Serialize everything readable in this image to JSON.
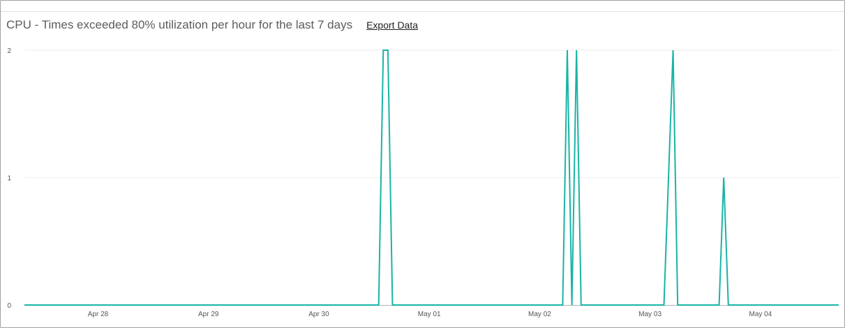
{
  "chart_data": {
    "type": "line",
    "title": "CPU - Times exceeded 80% utilization per hour for the last 7 days",
    "xlabel": "",
    "ylabel": "",
    "x_ticks": [
      "Apr 28",
      "Apr 29",
      "Apr 30",
      "May 01",
      "May 02",
      "May 03",
      "May 04"
    ],
    "y_ticks": [
      "0",
      "1",
      "2"
    ],
    "ylim": [
      0,
      2
    ],
    "xlim": [
      "Apr 27 08:00",
      "May 04 17:00"
    ],
    "grid": true,
    "legend": "none",
    "colors": {
      "line": "#18b4a6",
      "grid": "#ececec",
      "axis": "#b5b5b5"
    },
    "series": [
      {
        "points": [
          [
            "Apr 27 08:00",
            0
          ],
          [
            "Apr 30 13:00",
            0
          ],
          [
            "Apr 30 14:00",
            2
          ],
          [
            "Apr 30 15:00",
            2
          ],
          [
            "Apr 30 16:00",
            0
          ],
          [
            "May 02 05:00",
            0
          ],
          [
            "May 02 06:00",
            2
          ],
          [
            "May 02 07:00",
            0
          ],
          [
            "May 02 08:00",
            2
          ],
          [
            "May 02 09:00",
            0
          ],
          [
            "May 03 03:00",
            0
          ],
          [
            "May 03 05:00",
            2
          ],
          [
            "May 03 06:00",
            0
          ],
          [
            "May 03 15:00",
            0
          ],
          [
            "May 03 16:00",
            1
          ],
          [
            "May 03 17:00",
            0
          ],
          [
            "May 04 17:00",
            0
          ]
        ]
      }
    ]
  },
  "header": {
    "export_label": "Export Data"
  }
}
